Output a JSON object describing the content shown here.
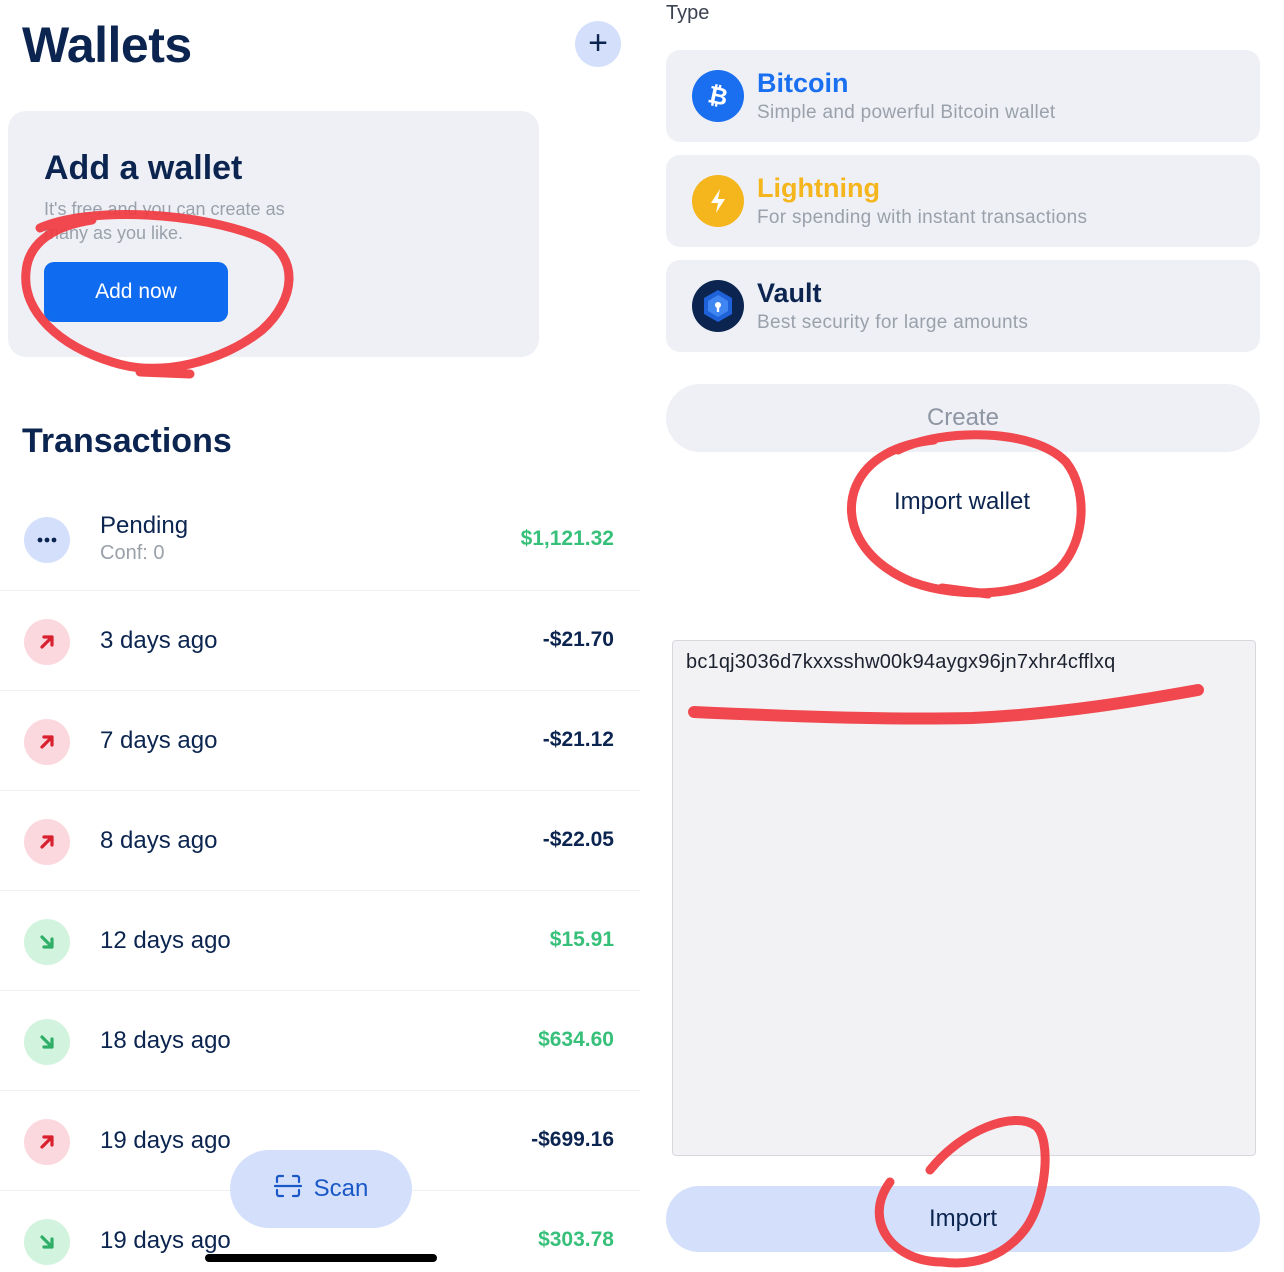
{
  "wallets_screen": {
    "title": "Wallets",
    "add_icon": "plus-icon",
    "add_card": {
      "title": "Add a wallet",
      "subtitle": "It's free and you can create as many as you like.",
      "button": "Add now"
    },
    "transactions_title": "Transactions",
    "transactions": [
      {
        "label": "Pending",
        "sub": "Conf: 0",
        "amount": "$1,121.32",
        "kind": "pending",
        "icon": "dots-icon"
      },
      {
        "label": "3 days ago",
        "amount": "-$21.70",
        "kind": "outgoing",
        "icon": "arrow-up-right-icon"
      },
      {
        "label": "7 days ago",
        "amount": "-$21.12",
        "kind": "outgoing",
        "icon": "arrow-up-right-icon"
      },
      {
        "label": "8 days ago",
        "amount": "-$22.05",
        "kind": "outgoing",
        "icon": "arrow-up-right-icon"
      },
      {
        "label": "12 days ago",
        "amount": "$15.91",
        "kind": "incoming",
        "icon": "arrow-down-right-icon"
      },
      {
        "label": "18 days ago",
        "amount": "$634.60",
        "kind": "incoming",
        "icon": "arrow-down-right-icon"
      },
      {
        "label": "19 days ago",
        "amount": "-$699.16",
        "kind": "outgoing",
        "icon": "arrow-up-right-icon"
      },
      {
        "label": "19 days ago",
        "amount": "$303.78",
        "kind": "incoming",
        "icon": "arrow-down-right-icon"
      }
    ],
    "scan_button": "Scan",
    "scan_icon": "scan-icon"
  },
  "add_wallet_screen": {
    "type_label": "Type",
    "types": [
      {
        "name": "Bitcoin",
        "desc": "Simple and powerful Bitcoin wallet",
        "icon": "bitcoin-icon",
        "color": "#1a6ff0"
      },
      {
        "name": "Lightning",
        "desc": "For spending with instant transactions",
        "icon": "lightning-icon",
        "color": "#f5b51d"
      },
      {
        "name": "Vault",
        "desc": "Best security for large amounts",
        "icon": "vault-icon",
        "color": "#0c2550"
      }
    ],
    "create_button": "Create",
    "import_wallet_link": "Import wallet",
    "import_text": "bc1qj3036d7kxxsshw00k94aygx96jn7xhr4cfflxq",
    "import_button": "Import"
  },
  "colors": {
    "navy": "#0c2550",
    "blue": "#0f6bf0",
    "green": "#37c07a",
    "red_annotation": "#f0393f",
    "card_bg": "#eef0f5"
  }
}
